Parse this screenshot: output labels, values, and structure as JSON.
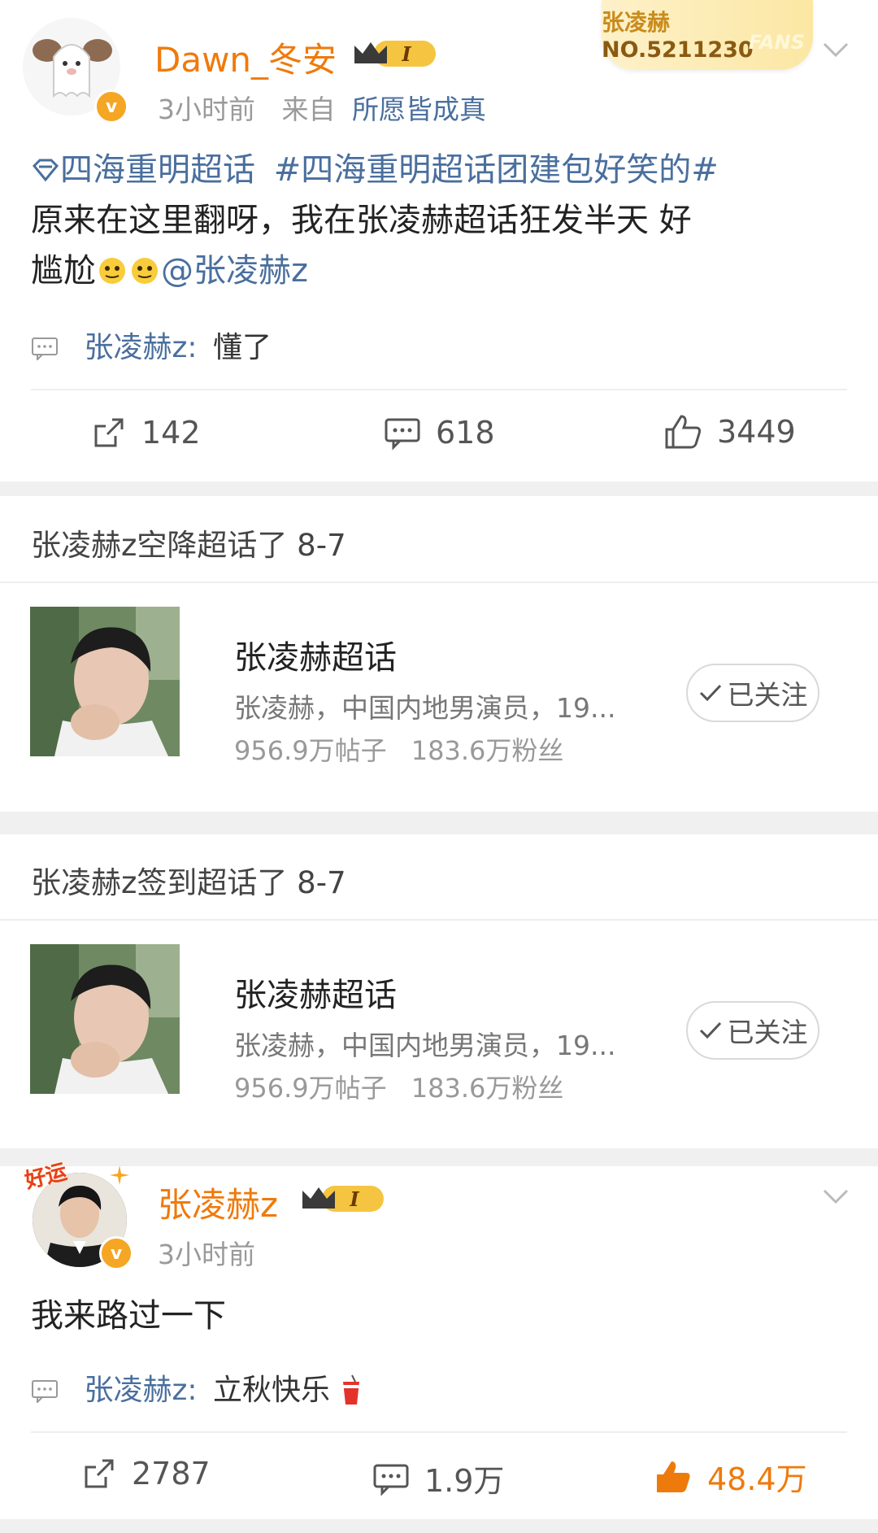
{
  "post1": {
    "username": "Dawn_冬安",
    "time": "3小时前",
    "source_prefix": "来自",
    "source": "所愿皆成真",
    "fans_card": {
      "name": "张凌赫",
      "number": "NO.5211230",
      "word": "FANS"
    },
    "supertopic_tag": "四海重明超话",
    "hashtag": "#四海重明超话团建包好笑的#",
    "text_line2": "原来在这里翻呀，我在张凌赫超话狂发半天 好",
    "text_line3_start": "尴尬",
    "mention": "@张凌赫z",
    "comment_name": "张凌赫z",
    "comment_text": "懂了",
    "repost_count": "142",
    "comment_count": "618",
    "like_count": "3449"
  },
  "section1": {
    "title": "张凌赫z空降超话了 8-7",
    "topic_title": "张凌赫超话",
    "topic_desc": "张凌赫，中国内地男演员，19...",
    "posts": "956.9万帖子",
    "fans": "183.6万粉丝",
    "follow_label": "已关注"
  },
  "section2": {
    "title": "张凌赫z签到超话了 8-7",
    "topic_title": "张凌赫超话",
    "topic_desc": "张凌赫，中国内地男演员，19...",
    "posts": "956.9万帖子",
    "fans": "183.6万粉丝",
    "follow_label": "已关注"
  },
  "post2": {
    "username": "张凌赫z",
    "time": "3小时前",
    "avatar_badge": "好运",
    "text": "我来路过一下",
    "comment_name": "张凌赫z",
    "comment_text": "立秋快乐",
    "repost_count": "2787",
    "comment_count": "1.9万",
    "like_count": "48.4万"
  },
  "badge_level": "I",
  "colors": {
    "accent": "#ef7a0c",
    "link": "#4a6f9e",
    "gold": "#f5c542"
  }
}
